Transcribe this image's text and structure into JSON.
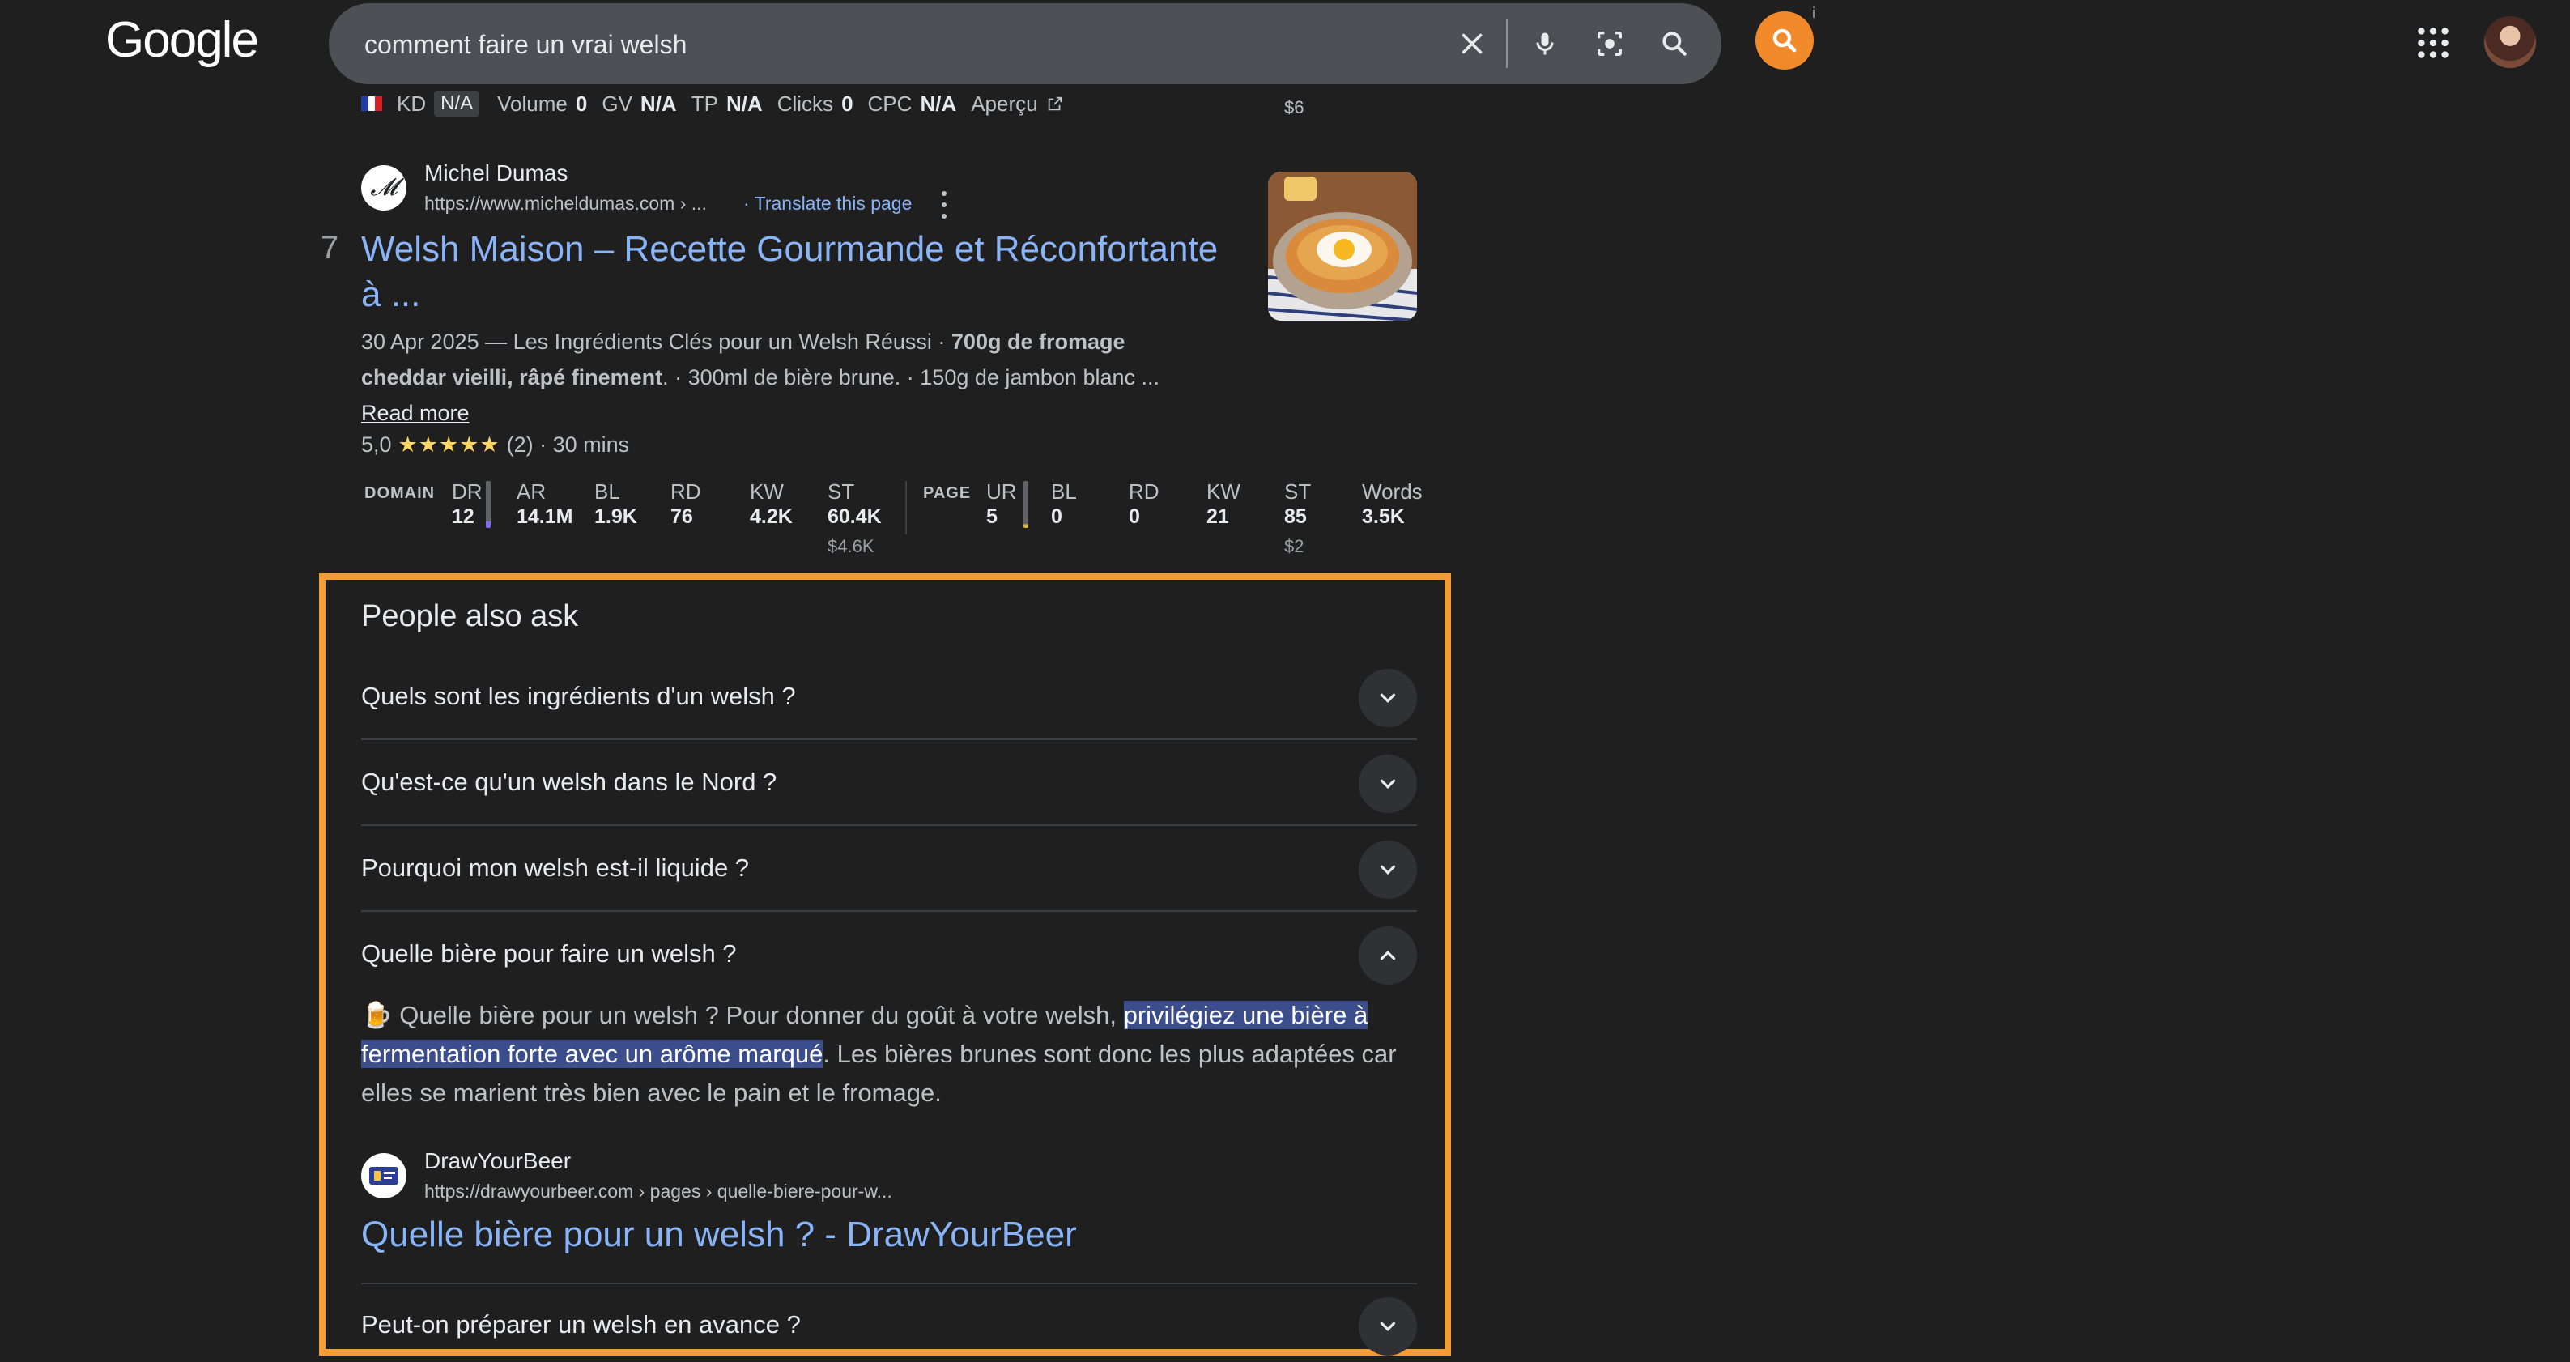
{
  "header": {
    "logo": "Google",
    "search_value": "comment faire un vrai welsh",
    "info_mark": "i"
  },
  "metrics_bar": {
    "kd_label": "KD",
    "kd_value": "N/A",
    "volume_label": "Volume",
    "volume_value": "0",
    "gv_label": "GV",
    "gv_value": "N/A",
    "tp_label": "TP",
    "tp_value": "N/A",
    "clicks_label": "Clicks",
    "clicks_value": "0",
    "cpc_label": "CPC",
    "cpc_value": "N/A",
    "apercu": "Aperçu",
    "price": "$6"
  },
  "result": {
    "rank": "7",
    "site_name": "Michel Dumas",
    "favicon_text": "𝓜",
    "url": "https://www.micheldumas.com › ...",
    "translate": "· Translate this page",
    "title": "Welsh Maison – Recette Gourmande et Réconfortante à ...",
    "snippet_part1": "30 Apr 2025 — Les Ingrédients Clés pour un Welsh Réussi · ",
    "snippet_bold": "700g de fromage cheddar vieilli, râpé finement",
    "snippet_part2": ". · 300ml de bière brune. · 150g de jambon blanc ... ",
    "read_more": "Read more",
    "rating_value": "5,0",
    "stars": "★★★★★",
    "rating_rest": "(2) · 30 mins"
  },
  "metrics_table": {
    "domain_label": "DOMAIN",
    "page_label": "PAGE",
    "domain": [
      {
        "h": "DR",
        "v": "12"
      },
      {
        "h": "AR",
        "v": "14.1M"
      },
      {
        "h": "BL",
        "v": "1.9K"
      },
      {
        "h": "RD",
        "v": "76"
      },
      {
        "h": "KW",
        "v": "4.2K"
      },
      {
        "h": "ST",
        "v": "60.4K",
        "sub": "$4.6K"
      }
    ],
    "page": [
      {
        "h": "UR",
        "v": "5"
      },
      {
        "h": "BL",
        "v": "0"
      },
      {
        "h": "RD",
        "v": "0"
      },
      {
        "h": "KW",
        "v": "21"
      },
      {
        "h": "ST",
        "v": "85",
        "sub": "$2"
      },
      {
        "h": "Words",
        "v": "3.5K"
      }
    ]
  },
  "paa": {
    "title": "People also ask",
    "questions": [
      "Quels sont les ingrédients d'un welsh ?",
      "Qu'est-ce qu'un welsh dans le Nord ?",
      "Pourquoi mon welsh est-il liquide ?",
      "Quelle bière pour faire un welsh ?",
      "Peut-on préparer un welsh en avance ?"
    ],
    "answer_emoji": "🍺",
    "answer_part1": " Quelle bière pour un welsh ? Pour donner du goût à votre welsh, ",
    "answer_highlight": "privilégiez une bière à fermentation forte avec un arôme marqué",
    "answer_part2": ". Les bières brunes sont donc les plus adaptées car elles se marient très bien avec le pain et le fromage.",
    "source_name": "DrawYourBeer",
    "source_url": "https://drawyourbeer.com › pages › quelle-biere-pour-w...",
    "source_title": "Quelle bière pour un welsh ? - DrawYourBeer"
  },
  "colors": {
    "background": "#1f1f1f",
    "link": "#8ab4f8",
    "highlight_border": "#f39c34",
    "answer_highlight": "#3c4d8b"
  }
}
